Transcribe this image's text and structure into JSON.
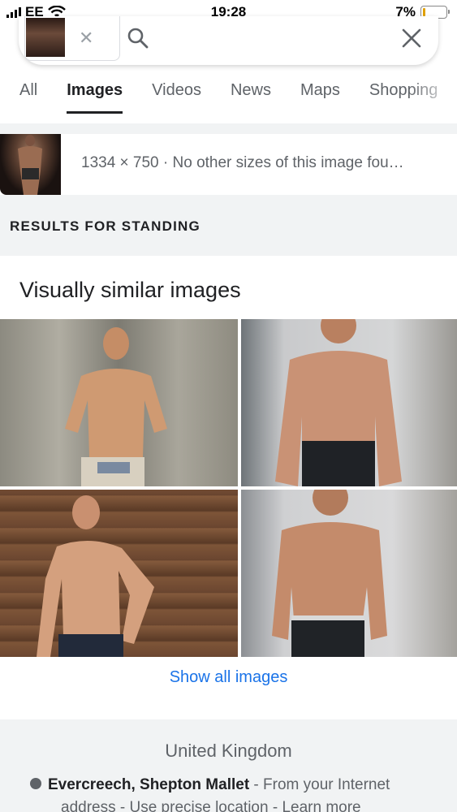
{
  "status_bar": {
    "carrier": "EE",
    "time": "19:28",
    "battery_percent": "7%",
    "battery_level": 0.07
  },
  "search": {
    "chip_close_icon": "close-icon",
    "search_icon": "search-icon",
    "clear_icon": "close-icon"
  },
  "tabs": [
    {
      "label": "All",
      "active": false
    },
    {
      "label": "Images",
      "active": true
    },
    {
      "label": "Videos",
      "active": false
    },
    {
      "label": "News",
      "active": false
    },
    {
      "label": "Maps",
      "active": false
    },
    {
      "label": "Shopping",
      "active": false
    }
  ],
  "image_info": {
    "text": "1334 × 750 · No other sizes of this image fou…"
  },
  "results_for": "RESULTS FOR STANDING",
  "similar": {
    "title": "Visually similar images",
    "show_all": "Show all images"
  },
  "footer": {
    "country": "United Kingdom",
    "location": "Evercreech, Shepton Mallet",
    "location_suffix": " - From your Internet",
    "line2": "address - Use precise location - Learn more"
  },
  "colors": {
    "link": "#1a73e8",
    "gray_band": "#f1f3f4",
    "battery_fill": "#e0a000"
  }
}
